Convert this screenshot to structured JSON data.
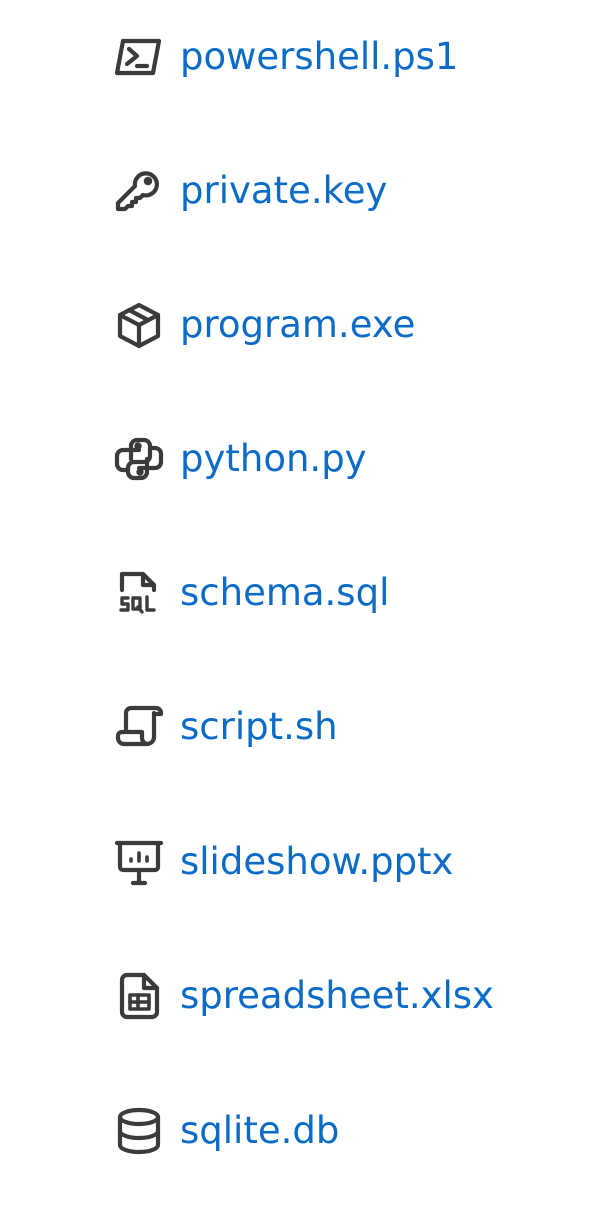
{
  "colors": {
    "link": "#0b6bc7",
    "icon": "#3b3b3b"
  },
  "files": [
    {
      "name": "powershell.ps1",
      "icon": "terminal-icon"
    },
    {
      "name": "private.key",
      "icon": "key-icon"
    },
    {
      "name": "program.exe",
      "icon": "package-icon"
    },
    {
      "name": "python.py",
      "icon": "python-icon"
    },
    {
      "name": "schema.sql",
      "icon": "sql-file-icon"
    },
    {
      "name": "script.sh",
      "icon": "script-icon"
    },
    {
      "name": "slideshow.pptx",
      "icon": "presentation-icon"
    },
    {
      "name": "spreadsheet.xlsx",
      "icon": "spreadsheet-icon"
    },
    {
      "name": "sqlite.db",
      "icon": "database-icon"
    }
  ]
}
